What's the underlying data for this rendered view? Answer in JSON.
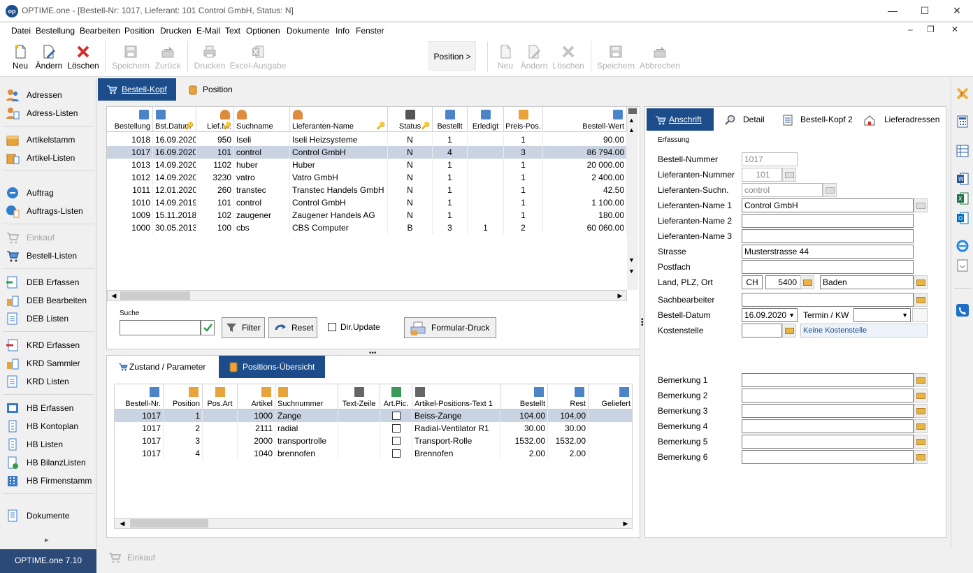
{
  "window": {
    "logo": "op",
    "title": "OPTIME.one  - [Bestell-Nr: 1017, Lieferant: 101 Control GmbH, Status: N]",
    "minimize": "—",
    "maximize": "☐",
    "close": "✕"
  },
  "menu": [
    "Datei",
    "Bestellung",
    "Bearbeiten",
    "Position",
    "Drucken",
    "E-Mail",
    "Text",
    "Optionen",
    "Dokumente",
    "Info",
    "Fenster"
  ],
  "toolbar": {
    "neu": "Neu",
    "aendern": "Ändern",
    "loeschen": "Löschen",
    "speichern": "Speichern",
    "zurueck": "Zurück",
    "drucken": "Drucken",
    "excel": "Excel-Ausgabe",
    "position_nav": "Position >",
    "pos_neu": "Neu",
    "pos_aendern": "Ändern",
    "pos_loeschen": "Löschen",
    "pos_speichern": "Speichern",
    "pos_abbrechen": "Abbrechen"
  },
  "sidebar": {
    "items": [
      "Adressen",
      "Adress-Listen",
      "Artikelstamm",
      "Artikel-Listen",
      "Auftrag",
      "Auftrags-Listen",
      "Einkauf",
      "Bestell-Listen",
      "DEB Erfassen",
      "DEB Bearbeiten",
      "DEB Listen",
      "KRD Erfassen",
      "KRD Sammler",
      "KRD Listen",
      "HB Erfassen",
      "HB Kontoplan",
      "HB Listen",
      "HB BilanzListen",
      "HB Firmenstamm",
      "Dokumente"
    ],
    "expand": "▸",
    "version": "OPTIME.one  7.10"
  },
  "bottom_task": "Einkauf",
  "main_tabs": [
    "Bestell-Kopf",
    "Position"
  ],
  "orders": {
    "columns": [
      "Bestellung",
      "Bst.Datum",
      "Lief.Nr.",
      "Suchname",
      "Lieferanten-Name",
      "Status",
      "Bestellt",
      "Erledigt",
      "Preis-Pos.",
      "Bestell-Wert"
    ],
    "rows": [
      [
        "1018",
        "16.09.2020",
        "950",
        "Iseli",
        "Iseli Heizsysteme",
        "N",
        "1",
        "",
        "1",
        "90.00"
      ],
      [
        "1017",
        "16.09.2020",
        "101",
        "control",
        "Control GmbH",
        "N",
        "4",
        "",
        "3",
        "86 794.00"
      ],
      [
        "1013",
        "14.09.2020",
        "1102",
        "huber",
        "Huber",
        "N",
        "1",
        "",
        "1",
        "20 000.00"
      ],
      [
        "1012",
        "14.09.2020",
        "3230",
        "vatro",
        "Vatro GmbH",
        "N",
        "1",
        "",
        "1",
        "2 400.00"
      ],
      [
        "1011",
        "12.01.2020",
        "260",
        "transtec",
        "Transtec Handels GmbH",
        "N",
        "1",
        "",
        "1",
        "42.50"
      ],
      [
        "1010",
        "14.09.2019",
        "101",
        "control",
        "Control GmbH",
        "N",
        "1",
        "",
        "1",
        "1 100.00"
      ],
      [
        "1009",
        "15.11.2018",
        "102",
        "zaugener",
        "Zaugener Handels AG",
        "N",
        "1",
        "",
        "1",
        "180.00"
      ],
      [
        "1000",
        "30.05.2013",
        "100",
        "cbs",
        "CBS Computer",
        "B",
        "3",
        "1",
        "2",
        "60 060.00"
      ]
    ]
  },
  "search": {
    "label": "Suche",
    "value": "",
    "filter": "Filter",
    "reset": "Reset",
    "dirupdate": "Dir.Update",
    "formular": "Formular-Druck"
  },
  "sub_tabs": [
    "Zustand / Parameter",
    "Positions-Übersicht"
  ],
  "positions": {
    "columns": [
      "Bestell-Nr.",
      "Position",
      "Pos.Art",
      "Artikel",
      "Suchnummer",
      "Text-Zeile",
      "Art.Pic.",
      "Artikel-Positions-Text 1",
      "Bestellt",
      "Rest",
      "Geliefert"
    ],
    "rows": [
      [
        "1017",
        "1",
        "",
        "1000",
        "Zange",
        "",
        "",
        "Beiss-Zange",
        "104.00",
        "104.00",
        ""
      ],
      [
        "1017",
        "2",
        "",
        "2111",
        "radial",
        "",
        "",
        "Radial-Ventilator R1",
        "30.00",
        "30.00",
        ""
      ],
      [
        "1017",
        "3",
        "",
        "2000",
        "transportrolle",
        "",
        "",
        "Transport-Rolle",
        "1532.00",
        "1532.00",
        ""
      ],
      [
        "1017",
        "4",
        "",
        "1040",
        "brennofen",
        "",
        "",
        "Brennofen",
        "2.00",
        "2.00",
        ""
      ]
    ]
  },
  "form_tabs": [
    "Anschrift",
    "Detail",
    "Bestell-Kopf 2",
    "Lieferadressen"
  ],
  "form": {
    "section": "Erfassung",
    "labels": {
      "bestellnr": "Bestell-Nummer",
      "liefnr": "Lieferanten-Nummer",
      "liefsuch": "Lieferanten-Suchn.",
      "name1": "Lieferanten-Name 1",
      "name2": "Lieferanten-Name 2",
      "name3": "Lieferanten-Name 3",
      "strasse": "Strasse",
      "postfach": "Postfach",
      "land": "Land, PLZ, Ort",
      "sachbearbeiter": "Sachbearbeiter",
      "datum": "Bestell-Datum",
      "termin": "Termin / KW",
      "kostenstelle": "Kostenstelle"
    },
    "values": {
      "bestellnr": "1017",
      "liefnr": "101",
      "liefsuch": "control",
      "name1": "Control GmbH",
      "name2": "",
      "name3": "",
      "strasse": "Musterstrasse 44",
      "postfach": "",
      "land": "CH",
      "plz": "5400",
      "ort": "Baden",
      "sachbearbeiter": "",
      "datum": "16.09.2020",
      "termin": "",
      "kostenstelle": "",
      "kostenstelle_text": "Keine Kostenstelle"
    },
    "bemerkungen": [
      "Bemerkung 1",
      "Bemerkung 2",
      "Bemerkung 3",
      "Bemerkung 4",
      "Bemerkung 5",
      "Bemerkung 6"
    ]
  },
  "colors": {
    "accent": "#1c4d8a",
    "selection": "#c9d3e2",
    "folder": "#e8b443"
  }
}
